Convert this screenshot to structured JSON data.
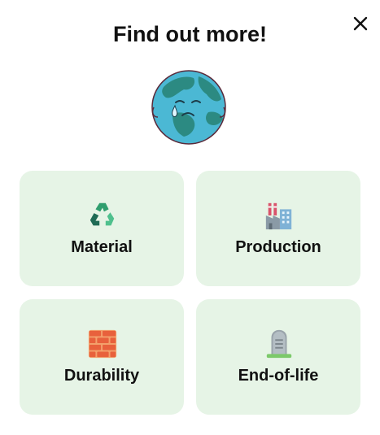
{
  "dialog": {
    "title": "Find out more!",
    "close_icon": "close-icon",
    "illustration": "crying-earth-icon"
  },
  "cards": [
    {
      "label": "Material",
      "icon": "recycle-icon"
    },
    {
      "label": "Production",
      "icon": "factory-icon"
    },
    {
      "label": "Durability",
      "icon": "brick-icon"
    },
    {
      "label": "End-of-life",
      "icon": "tombstone-icon"
    }
  ],
  "colors": {
    "card_background": "#e6f4e6",
    "text": "#111111",
    "earth_ocean": "#4bb8d4",
    "earth_land": "#2c8a82"
  }
}
